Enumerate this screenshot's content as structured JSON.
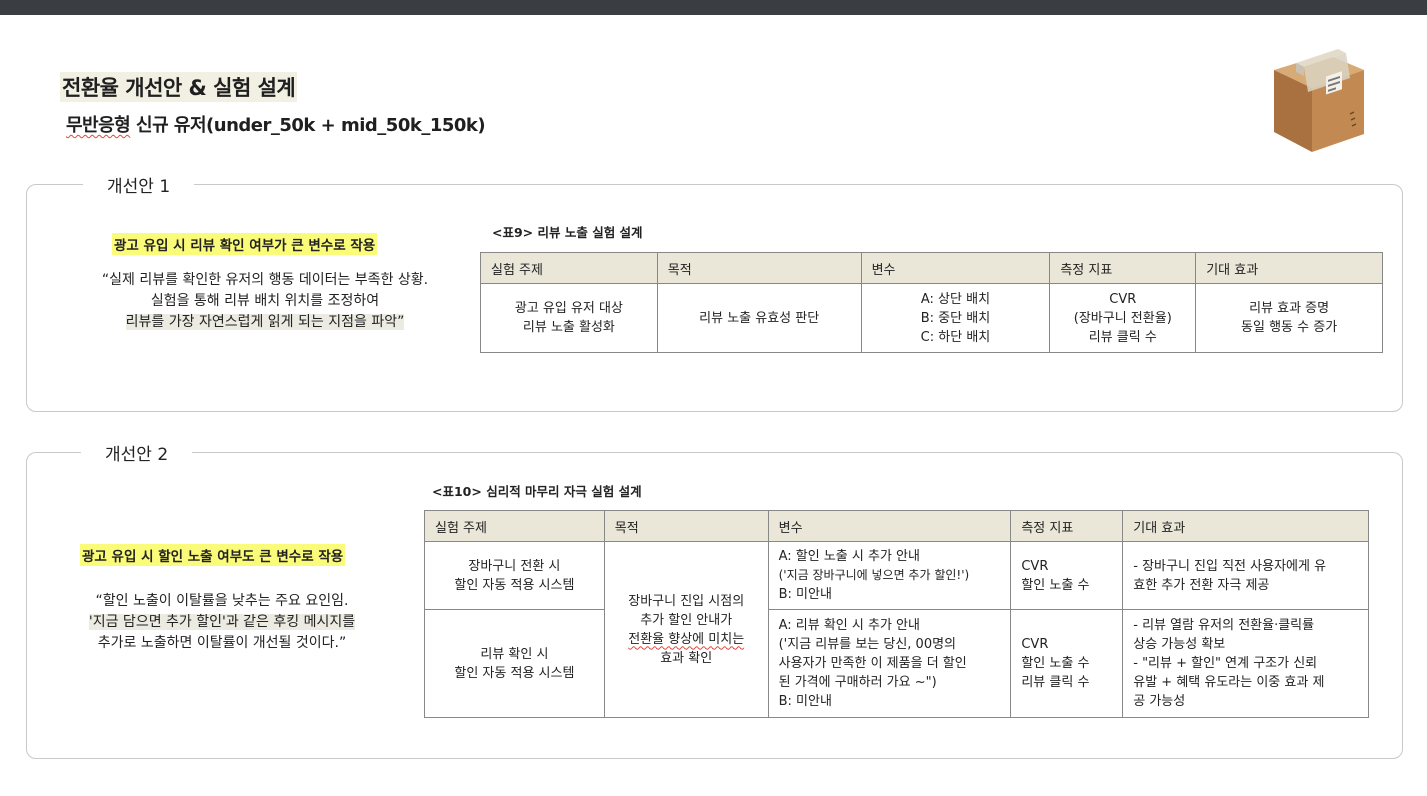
{
  "header": {
    "title": "전환율 개선안 & 실험 설계",
    "subtitle_prefix": "무반응형",
    "subtitle_rest": " 신규 유저(under_50k + mid_50k_150k)"
  },
  "box_icon": "cardboard-box-icon",
  "proposal1": {
    "label": "개선안 1",
    "headline": "광고 유입 시 리뷰 확인 여부가 큰 변수로 작용",
    "quote": [
      "“실제 리뷰를 확인한 유저의 행동 데이터는 부족한 상황.",
      "실험을 통해 리뷰 배치 위치를 조정하여",
      "리뷰를 가장 자연스럽게 읽게 되는 지점을 파악”"
    ],
    "table_caption": "<표9> 리뷰 노출 실험 설계",
    "headers": [
      "실험 주제",
      "목적",
      "변수",
      "측정 지표",
      "기대 효과"
    ],
    "row": {
      "topic": [
        "광고 유입 유저 대상",
        "리뷰 노출 활성화"
      ],
      "purpose": "리뷰 노출 유효성 판단",
      "variables": [
        "A: 상단 배치",
        "B: 중단 배치",
        "C: 하단 배치"
      ],
      "metrics": [
        "CVR",
        "(장바구니 전환율)",
        "리뷰 클릭 수"
      ],
      "effect": [
        "리뷰 효과 증명",
        "동일 행동 수 증가"
      ]
    }
  },
  "proposal2": {
    "label": "개선안 2",
    "headline": "광고 유입 시 할인 노출 여부도 큰 변수로 작용",
    "quote": [
      "“할인 노출이 이탈률을 낮추는 주요 요인임.",
      "'지금 담으면 추가 할인'과 같은 후킹 메시지를",
      "추가로 노출하면 이탈률이 개선될 것이다.”"
    ],
    "table_caption": "<표10> 심리적 마무리 자극 실험 설계",
    "headers": [
      "실험 주제",
      "목적",
      "변수",
      "측정 지표",
      "기대 효과"
    ],
    "purpose": [
      "장바구니 진입 시점의",
      "추가 할인 안내가",
      "전환율 향상에 미치는",
      "효과 확인"
    ],
    "rows": [
      {
        "topic": [
          "장바구니 전환 시",
          "할인 자동 적용 시스템"
        ],
        "variables": [
          "A: 할인 노출 시 추가 안내",
          "('지금 장바구니에 넣으면 추가 할인!')",
          "B: 미안내"
        ],
        "metrics": [
          "CVR",
          "할인 노출 수"
        ],
        "effect": [
          "- 장바구니 진입 직전 사용자에게 유",
          "효한 추가 전환 자극 제공"
        ]
      },
      {
        "topic": [
          "리뷰 확인 시",
          "할인 자동 적용 시스템"
        ],
        "variables": [
          "A: 리뷰 확인 시 추가 안내",
          "('지금 리뷰를 보는 당신, 00명의",
          "사용자가 만족한 이 제품을 더 할인",
          "된 가격에 구매하러 가요 ~\")",
          "B: 미안내"
        ],
        "metrics": [
          "CVR",
          "할인 노출 수",
          "리뷰 클릭 수"
        ],
        "effect": [
          "- 리뷰 열람 유저의 전환율·클릭률",
          "상승 가능성 확보",
          "- \"리뷰 + 할인\" 연계 구조가 신뢰",
          "유발 + 혜택 유도라는 이중 효과 제",
          "공 가능성"
        ]
      }
    ]
  }
}
